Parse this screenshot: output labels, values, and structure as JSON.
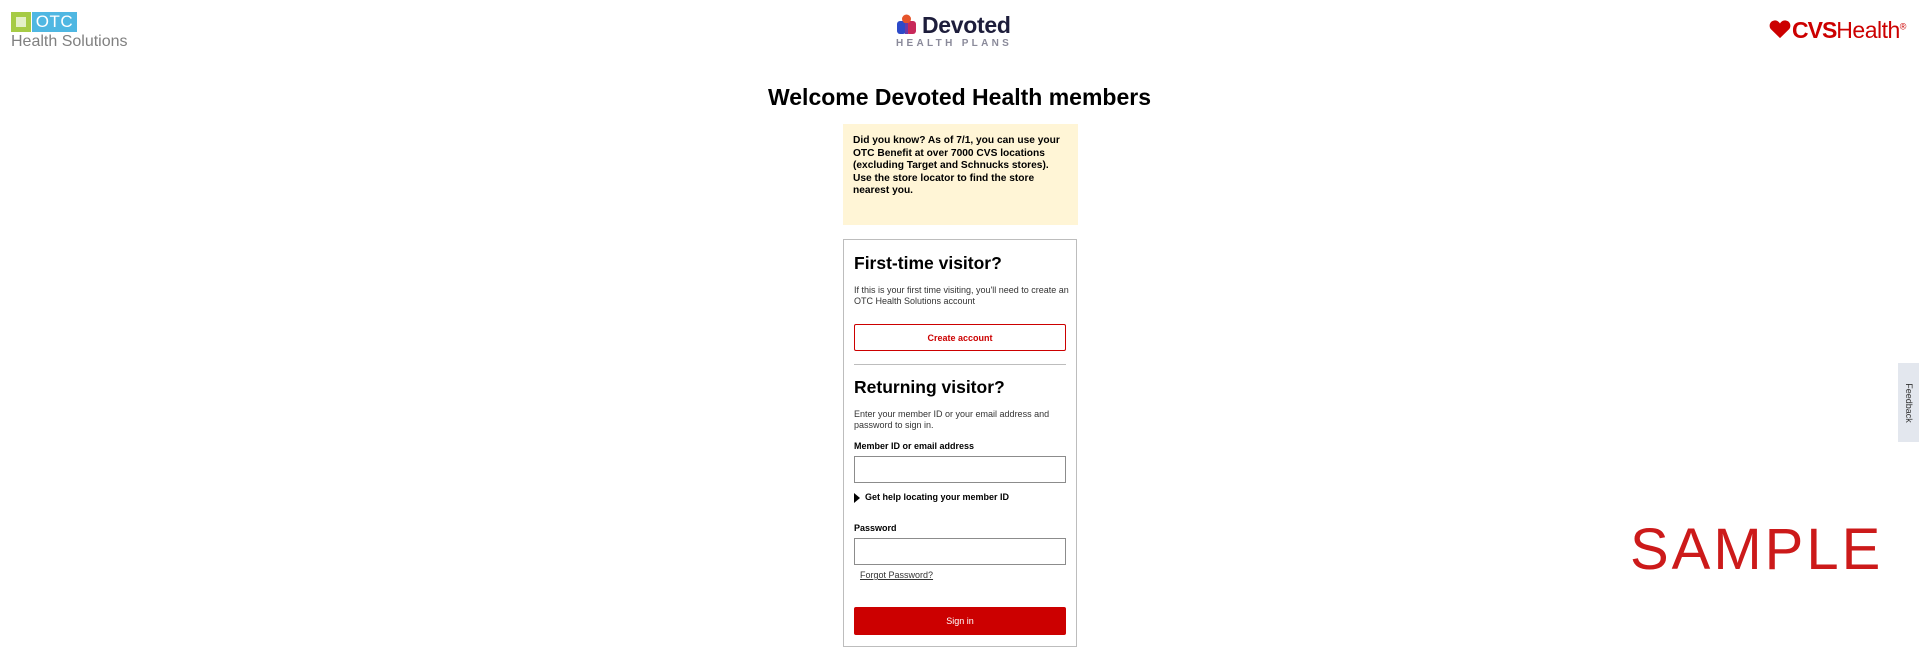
{
  "header": {
    "otc_logo": {
      "badge": "OTC",
      "subtitle": "Health Solutions"
    },
    "devoted_logo": {
      "wordmark": "Devoted",
      "subtitle": "HEALTH PLANS"
    },
    "cvs_logo": {
      "cvs": "CVS",
      "health": "Health",
      "registered": "®"
    }
  },
  "main": {
    "title": "Welcome Devoted Health members",
    "notice": "Did you know? As of 7/1, you can use your OTC Benefit at over 7000 CVS locations (excluding Target and Schnucks stores). Use the store locator to find the store nearest you."
  },
  "first_time": {
    "heading": "First-time visitor?",
    "description": "If this is your first time visiting, you'll need to create an OTC Health Solutions account",
    "create_button": "Create account"
  },
  "returning": {
    "heading": "Returning visitor?",
    "description": "Enter your member ID or your email address and password to sign in.",
    "member_label": "Member ID or email address",
    "member_value": "",
    "help_link": "Get help locating your member ID",
    "password_label": "Password",
    "password_value": "",
    "forgot_link": "Forgot Password?",
    "signin_button": "Sign in"
  },
  "feedback": {
    "label": "Feedback"
  },
  "watermark": "SAMPLE",
  "colors": {
    "cvs_red": "#cc0000",
    "otc_green": "#a6cb45",
    "otc_blue": "#4fb7e2",
    "notice_bg": "#fff5d6",
    "feedback_bg": "#e3e7ee"
  }
}
